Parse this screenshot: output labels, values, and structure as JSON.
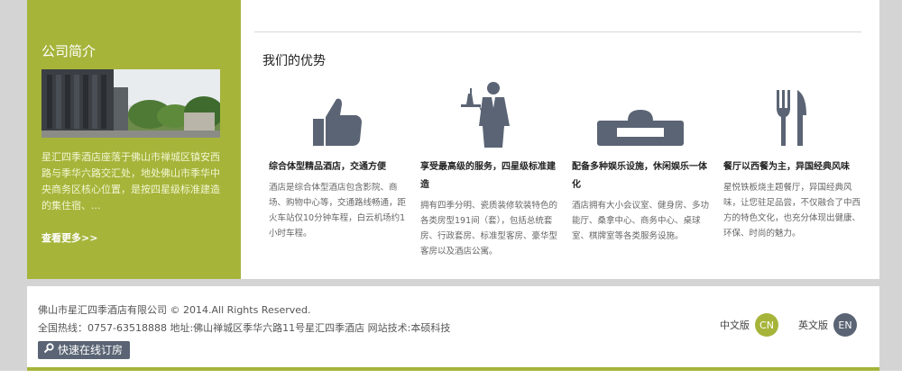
{
  "sidebar": {
    "title": "公司简介",
    "desc": "星汇四季酒店座落于佛山市禅城区镇安西路与季华六路交汇处，地处佛山市季华中央商务区核心位置，是按四星级标准建造的集住宿、...",
    "more": "查看更多>>"
  },
  "advantages": {
    "title": "我们的优势",
    "items": [
      {
        "icon": "thumbs-up-icon",
        "title": "综合体型精品酒店，交通方便",
        "desc": "酒店是综合体型酒店包含影院、商场、购物中心等，交通路线畅通，距火车站仅10分钟车程，白云机场约1小时车程。"
      },
      {
        "icon": "waiter-icon",
        "title": "享受最高级的服务，四星级标准建造",
        "desc": "拥有四季分明、瓷质装修软装特色的各类房型191间（套），包括总统套房、行政套房、标准型客房、豪华型客房以及酒店公寓。"
      },
      {
        "icon": "sofa-icon",
        "title": "配备多种娱乐设施，休闲娱乐一体化",
        "desc": "酒店拥有大小会议室、健身房、多功能厅、桑拿中心、商务中心、桌球室、棋牌室等各类服务设施。"
      },
      {
        "icon": "fork-knife-icon",
        "title": "餐厅以西餐为主，异国经典风味",
        "desc": "星悦铁板烧主题餐厅，异国经典风味，让您驻足品尝，不仅融合了中西方的特色文化，也充分体现出健康、环保、时尚的魅力。"
      }
    ]
  },
  "footer": {
    "copyright": "佛山市星汇四季酒店有限公司 © 2014.All Rights Reserved.",
    "contact": "全国热线：0757-63518888 地址:佛山禅城区季华六路11号星汇四季酒店 网站技术:本硕科技",
    "book_label": "快速在线订房",
    "lang_cn_label": "中文版",
    "lang_cn_badge": "CN",
    "lang_en_label": "英文版",
    "lang_en_badge": "EN"
  },
  "colors": {
    "accent": "#a6b43a",
    "icon": "#5a6474",
    "book_button": "#5a6474"
  }
}
